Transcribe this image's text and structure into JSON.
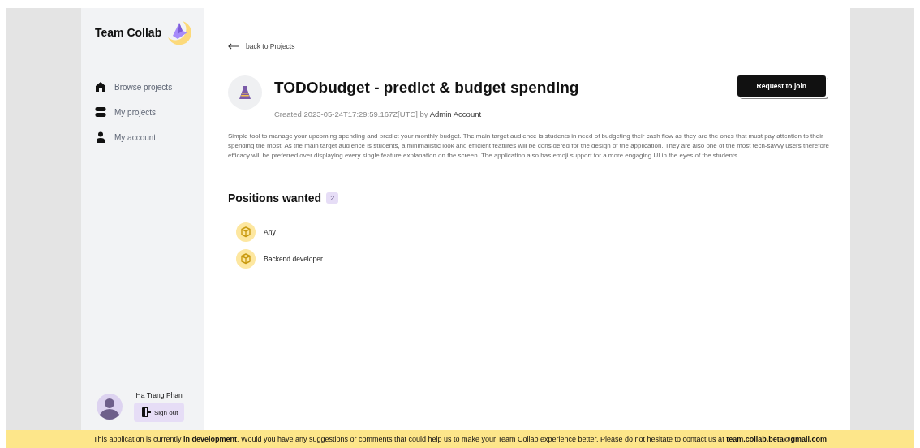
{
  "sidebar": {
    "brand": "Team Collab",
    "items": [
      {
        "label": "Browse projects"
      },
      {
        "label": "My projects"
      },
      {
        "label": "My account"
      }
    ],
    "user": {
      "name": "Ha Trang Phan",
      "sign_out": "Sign out"
    }
  },
  "back_link": "back to Projects",
  "project": {
    "title": "TODObudget - predict & budget spending",
    "created": "Created 2023-05-24T17:29:59.167Z[UTC] by",
    "author": "Admin Account",
    "join_button": "Request to join",
    "description": "Simple tool to manage your upcoming spending and predict your monthly budget. The main target audience is students in need of budgeting their cash flow as they are the ones that must pay attention to their spending the most. As the main target audience is students, a minimalistic look and efficient features will be considered for the design of the application. They are also one of the most tech-savvy users therefore efficacy will be preferred over displaying every single feature explanation on the screen. The application also has emoji support for a more engaging UI in the eyes of the students."
  },
  "positions": {
    "title": "Positions wanted",
    "count": "2",
    "items": [
      {
        "label": "Any"
      },
      {
        "label": "Backend developer"
      }
    ]
  },
  "footer": "This application is currently **in development**. Would you have any suggestions or comments that could help us to make your Team Collab experience better. Please do not hesitate to contact us at **team.collab.beta@gmail.com**"
}
